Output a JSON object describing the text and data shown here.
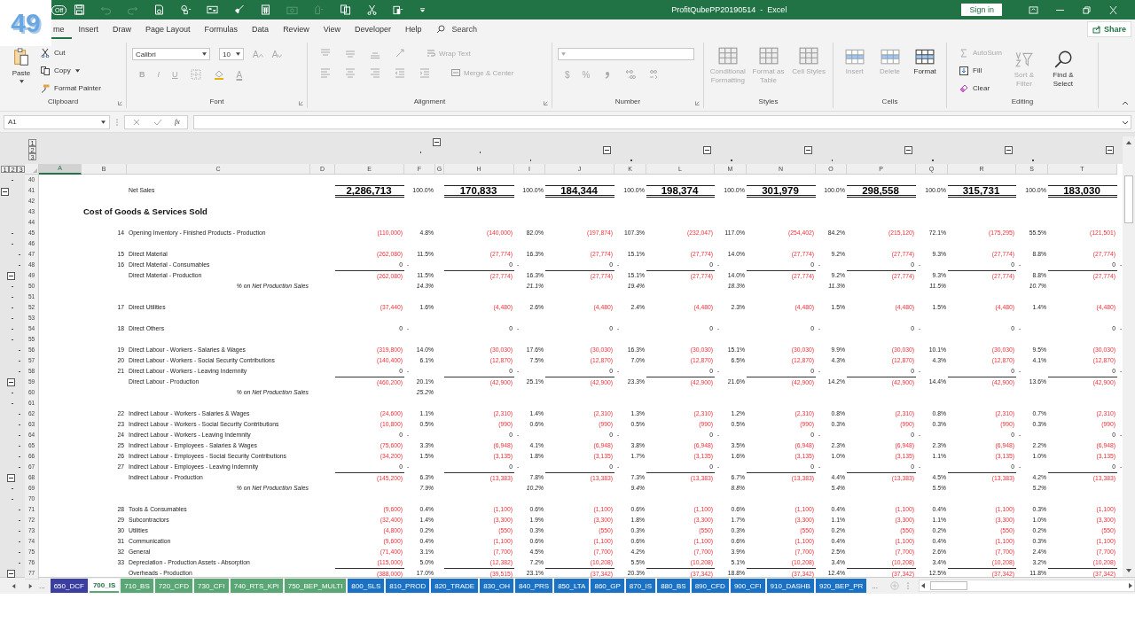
{
  "badge": "49",
  "title_bar": {
    "autosave": "Off",
    "title": "ProfitQubePP20190514  -  Excel",
    "sign_in": "Sign in",
    "quick_access": [
      {
        "kind": "save",
        "disabled": false
      },
      {
        "kind": "undo",
        "disabled": true
      },
      {
        "kind": "redo",
        "disabled": true
      },
      {
        "kind": "doc",
        "disabled": false
      },
      {
        "kind": "touch",
        "disabled": false
      },
      {
        "kind": "form",
        "disabled": false
      },
      {
        "kind": "brush",
        "disabled": false
      },
      {
        "kind": "calc",
        "disabled": false
      },
      {
        "kind": "camera",
        "disabled": true
      },
      {
        "kind": "hand",
        "disabled": true
      },
      {
        "kind": "copy",
        "disabled": false
      },
      {
        "kind": "cut",
        "disabled": false
      },
      {
        "kind": "paste",
        "disabled": false
      },
      {
        "kind": "more",
        "disabled": false
      }
    ]
  },
  "menu": {
    "tabs": [
      {
        "label": "me",
        "selected": true
      },
      {
        "label": "Insert",
        "selected": false
      },
      {
        "label": "Draw",
        "selected": false
      },
      {
        "label": "Page Layout",
        "selected": false
      },
      {
        "label": "Formulas",
        "selected": false
      },
      {
        "label": "Data",
        "selected": false
      },
      {
        "label": "Review",
        "selected": false
      },
      {
        "label": "View",
        "selected": false
      },
      {
        "label": "Developer",
        "selected": false
      },
      {
        "label": "Help",
        "selected": false
      }
    ],
    "search": {
      "placeholder": "Search"
    },
    "share": "Share"
  },
  "ribbon": {
    "clipboard": {
      "label": "Clipboard",
      "paste": "Paste",
      "cut": "Cut",
      "copy": "Copy",
      "format_painter": "Format Painter"
    },
    "font": {
      "label": "Font",
      "name": "Calibri",
      "size": "10",
      "disabled": true,
      "grow": "A",
      "shrink": "A",
      "bold": "B",
      "italic": "I",
      "underline": "U",
      "color_letter": "A"
    },
    "alignment": {
      "label": "Alignment",
      "disabled": true,
      "wrap_text": "Wrap Text",
      "merge": "Merge & Center"
    },
    "number": {
      "label": "Number",
      "disabled": true,
      "currency": "$",
      "percent": "%"
    },
    "styles": {
      "label": "Styles",
      "buttons": [
        {
          "label": "Conditional Formatting",
          "disabled": true
        },
        {
          "label": "Format as Table",
          "disabled": true
        },
        {
          "label": "Cell Styles",
          "disabled": true
        }
      ]
    },
    "cells": {
      "label": "Cells",
      "buttons": [
        {
          "label": "Insert",
          "disabled": true
        },
        {
          "label": "Delete",
          "disabled": true
        },
        {
          "label": "Format",
          "disabled": false
        }
      ]
    },
    "editing": {
      "label": "Editing",
      "autosum": {
        "label": "AutoSum",
        "disabled": true
      },
      "fill": {
        "label": "Fill",
        "disabled": false
      },
      "clear": {
        "label": "Clear",
        "disabled": false
      },
      "sort": {
        "label": "Sort & Filter",
        "disabled": true
      },
      "find": {
        "label": "Find & Select",
        "disabled": false
      }
    }
  },
  "formula_bar": {
    "name_box": "A1",
    "fx": "fx"
  },
  "sheet": {
    "column_level_buttons": [
      "1",
      "2",
      "3"
    ],
    "row_level_buttons": [
      "1",
      "2",
      "3"
    ],
    "columns": [
      {
        "letter": "A",
        "selected": true
      },
      {
        "letter": "B",
        "selected": false
      },
      {
        "letter": "C",
        "selected": false
      },
      {
        "letter": "D",
        "selected": false
      },
      {
        "letter": "E",
        "selected": false
      },
      {
        "letter": "F",
        "selected": false,
        "outline": {
          "kind": "dot-mid"
        }
      },
      {
        "letter": "G",
        "selected": false,
        "outline": {
          "kind": "collapse-outer"
        }
      },
      {
        "letter": "H",
        "selected": false,
        "outline": {
          "kind": "dot-mid"
        }
      },
      {
        "letter": "I",
        "selected": false,
        "outline": {
          "kind": "dot-inner"
        }
      },
      {
        "letter": "J",
        "selected": false,
        "outline": {
          "kind": "collapse-mid"
        }
      },
      {
        "letter": "K",
        "selected": false,
        "outline": {
          "kind": "dot-inner"
        }
      },
      {
        "letter": "L",
        "selected": false,
        "outline": {
          "kind": "collapse-mid"
        }
      },
      {
        "letter": "M",
        "selected": false,
        "outline": {
          "kind": "dot-inner"
        }
      },
      {
        "letter": "N",
        "selected": false,
        "outline": {
          "kind": "collapse-mid"
        }
      },
      {
        "letter": "O",
        "selected": false,
        "outline": {
          "kind": "dot-inner"
        }
      },
      {
        "letter": "P",
        "selected": false,
        "outline": {
          "kind": "collapse-mid"
        }
      },
      {
        "letter": "Q",
        "selected": false,
        "outline": {
          "kind": "dot-inner"
        }
      },
      {
        "letter": "R",
        "selected": false,
        "outline": {
          "kind": "collapse-mid"
        }
      },
      {
        "letter": "S",
        "selected": false,
        "outline": {
          "kind": "dot-inner"
        }
      },
      {
        "letter": "T",
        "selected": false,
        "outline": {
          "kind": "collapse-mid"
        }
      }
    ],
    "rows": [
      {
        "row": "40",
        "outline": {
          "kind": "dot-mid"
        },
        "kind": "blank"
      },
      {
        "row": "41",
        "outline": {
          "kind": "collapse-outer"
        },
        "kind": "total",
        "label": "Net Sales",
        "values": [
          "2,286,713",
          "170,833",
          "184,344",
          "198,374",
          "301,979",
          "298,558",
          "315,731",
          "183,030"
        ],
        "shares": [
          "100.0%",
          "100.0%",
          "100.0%",
          "100.0%",
          "100.0%",
          "100.0%",
          "100.0%"
        ]
      },
      {
        "row": "42",
        "kind": "blank"
      },
      {
        "row": "43",
        "kind": "heading",
        "label": "Cost of Goods & Services Sold"
      },
      {
        "row": "44",
        "kind": "blank"
      },
      {
        "row": "45",
        "outline": {
          "kind": "dot-mid"
        },
        "kind": "item",
        "code": "14",
        "label": "Opening Inventory - Finished Products - Production",
        "values": [
          "(110,000)",
          "(140,000)",
          "(197,874)",
          "(232,047)",
          "(254,402)",
          "(215,120)",
          "(175,295)",
          "(121,501)"
        ],
        "shares": [
          "4.8%",
          "82.0%",
          "107.3%",
          "117.0%",
          "84.2%",
          "72.1%",
          "55.5%"
        ]
      },
      {
        "row": "46",
        "outline": {
          "kind": "dot-mid"
        },
        "kind": "blank"
      },
      {
        "row": "47",
        "outline": {
          "kind": "dot-inner"
        },
        "kind": "item",
        "code": "15",
        "label": "Direct Material",
        "values": [
          "(262,080)",
          "(27,774)",
          "(27,774)",
          "(27,774)",
          "(27,774)",
          "(27,774)",
          "(27,774)",
          "(27,774)"
        ],
        "shares": [
          "11.5%",
          "16.3%",
          "15.1%",
          "14.0%",
          "9.2%",
          "9.3%",
          "8.8%"
        ]
      },
      {
        "row": "48",
        "outline": {
          "kind": "dot-inner"
        },
        "kind": "zero",
        "code": "16",
        "label": "Direct Material - Consumables",
        "values": [
          "0",
          "0",
          "0",
          "0",
          "0",
          "0",
          "0",
          "0"
        ],
        "dashes": [
          "-",
          "-",
          "-",
          "-",
          "-",
          "-",
          "-",
          "-"
        ]
      },
      {
        "row": "49",
        "outline": {
          "kind": "collapse-mid"
        },
        "kind": "subtotal",
        "label": "Direct Material - Production",
        "values": [
          "(262,080)",
          "(27,774)",
          "(27,774)",
          "(27,774)",
          "(27,774)",
          "(27,774)",
          "(27,774)",
          "(27,774)"
        ],
        "shares": [
          "11.5%",
          "16.3%",
          "15.1%",
          "14.0%",
          "9.2%",
          "9.3%",
          "8.8%"
        ]
      },
      {
        "row": "50",
        "outline": {
          "kind": "dot-mid"
        },
        "kind": "ratio",
        "label": "% on Net Production Sales",
        "shares": [
          "14.3%",
          "21.1%",
          "19.4%",
          "18.3%",
          "11.3%",
          "11.5%",
          "10.7%"
        ]
      },
      {
        "row": "51",
        "outline": {
          "kind": "dot-mid"
        },
        "kind": "blank"
      },
      {
        "row": "52",
        "outline": {
          "kind": "dot-mid"
        },
        "kind": "item",
        "code": "17",
        "label": "Direct Utilities",
        "values": [
          "(37,440)",
          "(4,480)",
          "(4,480)",
          "(4,480)",
          "(4,480)",
          "(4,480)",
          "(4,480)",
          "(4,480)"
        ],
        "shares": [
          "1.6%",
          "2.6%",
          "2.4%",
          "2.3%",
          "1.5%",
          "1.5%",
          "1.4%"
        ]
      },
      {
        "row": "53",
        "outline": {
          "kind": "dot-mid"
        },
        "kind": "blank"
      },
      {
        "row": "54",
        "outline": {
          "kind": "dot-mid"
        },
        "kind": "zero",
        "code": "18",
        "label": "Direct Others",
        "values": [
          "0",
          "0",
          "0",
          "0",
          "0",
          "0",
          "0",
          "0"
        ],
        "dashes": [
          "-",
          "-",
          "-",
          "-",
          "-",
          "-",
          "-",
          "-"
        ]
      },
      {
        "row": "55",
        "outline": {
          "kind": "dot-mid"
        },
        "kind": "blank"
      },
      {
        "row": "56",
        "outline": {
          "kind": "dot-inner"
        },
        "kind": "item",
        "code": "19",
        "label": "Direct Labour - Workers - Salaries & Wages",
        "values": [
          "(319,800)",
          "(30,030)",
          "(30,030)",
          "(30,030)",
          "(30,030)",
          "(30,030)",
          "(30,030)",
          "(30,030)"
        ],
        "shares": [
          "14.0%",
          "17.6%",
          "16.3%",
          "15.1%",
          "9.9%",
          "10.1%",
          "9.5%"
        ]
      },
      {
        "row": "57",
        "outline": {
          "kind": "dot-inner"
        },
        "kind": "item",
        "code": "20",
        "label": "Direct Labour - Workers - Social Security Contributions",
        "values": [
          "(140,400)",
          "(12,870)",
          "(12,870)",
          "(12,870)",
          "(12,870)",
          "(12,870)",
          "(12,870)",
          "(12,870)"
        ],
        "shares": [
          "6.1%",
          "7.5%",
          "7.0%",
          "6.5%",
          "4.3%",
          "4.3%",
          "4.1%"
        ]
      },
      {
        "row": "58",
        "outline": {
          "kind": "dot-inner"
        },
        "kind": "zero",
        "code": "21",
        "label": "Direct Labour - Workers - Leaving Indemnity",
        "values": [
          "0",
          "0",
          "0",
          "0",
          "0",
          "0",
          "0",
          "0"
        ],
        "dashes": [
          "-",
          "-",
          "-",
          "-",
          "-",
          "-",
          "-",
          "-"
        ]
      },
      {
        "row": "59",
        "outline": {
          "kind": "collapse-mid"
        },
        "kind": "subtotal",
        "label": "Direct Labour - Production",
        "values": [
          "(460,200)",
          "(42,900)",
          "(42,900)",
          "(42,900)",
          "(42,900)",
          "(42,900)",
          "(42,900)",
          "(42,900)"
        ],
        "shares": [
          "20.1%",
          "25.1%",
          "23.3%",
          "21.6%",
          "14.2%",
          "14.4%",
          "13.6%"
        ]
      },
      {
        "row": "60",
        "outline": {
          "kind": "dot-mid"
        },
        "kind": "ratio",
        "label": "% on Net Production Sales",
        "shares": [
          "25.2%"
        ]
      },
      {
        "row": "61",
        "outline": {
          "kind": "dot-mid"
        },
        "kind": "blank"
      },
      {
        "row": "62",
        "outline": {
          "kind": "dot-inner"
        },
        "kind": "item",
        "code": "22",
        "label": "Indirect Labour - Workers - Salaries & Wages",
        "values": [
          "(24,600)",
          "(2,310)",
          "(2,310)",
          "(2,310)",
          "(2,310)",
          "(2,310)",
          "(2,310)",
          "(2,310)"
        ],
        "shares": [
          "1.1%",
          "1.4%",
          "1.3%",
          "1.2%",
          "0.8%",
          "0.8%",
          "0.7%"
        ]
      },
      {
        "row": "63",
        "outline": {
          "kind": "dot-inner"
        },
        "kind": "item",
        "code": "23",
        "label": "Indirect Labour - Workers - Social Security Contributions",
        "values": [
          "(10,800)",
          "(990)",
          "(990)",
          "(990)",
          "(990)",
          "(990)",
          "(990)",
          "(990)"
        ],
        "shares": [
          "0.5%",
          "0.6%",
          "0.5%",
          "0.5%",
          "0.3%",
          "0.3%",
          "0.3%"
        ]
      },
      {
        "row": "64",
        "outline": {
          "kind": "dot-inner"
        },
        "kind": "zero",
        "code": "24",
        "label": "Indirect Labour - Workers - Leaving Indemnity",
        "values": [
          "0",
          "0",
          "0",
          "0",
          "0",
          "0",
          "0",
          "0"
        ],
        "dashes": [
          "-",
          "-",
          "-",
          "-",
          "-",
          "-",
          "-",
          "-"
        ]
      },
      {
        "row": "65",
        "outline": {
          "kind": "dot-inner"
        },
        "kind": "item",
        "code": "25",
        "label": "Indirect Labour - Employees - Salaries & Wages",
        "values": [
          "(75,600)",
          "(6,948)",
          "(6,948)",
          "(6,948)",
          "(6,948)",
          "(6,948)",
          "(6,948)",
          "(6,948)"
        ],
        "shares": [
          "3.3%",
          "4.1%",
          "3.8%",
          "3.5%",
          "2.3%",
          "2.3%",
          "2.2%"
        ]
      },
      {
        "row": "66",
        "outline": {
          "kind": "dot-inner"
        },
        "kind": "item",
        "code": "26",
        "label": "Indirect Labour - Employees - Social Security Contributions",
        "values": [
          "(34,200)",
          "(3,135)",
          "(3,135)",
          "(3,135)",
          "(3,135)",
          "(3,135)",
          "(3,135)",
          "(3,135)"
        ],
        "shares": [
          "1.5%",
          "1.8%",
          "1.7%",
          "1.6%",
          "1.0%",
          "1.1%",
          "1.0%"
        ]
      },
      {
        "row": "67",
        "outline": {
          "kind": "dot-inner"
        },
        "kind": "zero",
        "code": "27",
        "label": "Indirect Labour - Employees - Leaving Indemnity",
        "values": [
          "0",
          "0",
          "0",
          "0",
          "0",
          "0",
          "0",
          "0"
        ],
        "dashes": [
          "-",
          "-",
          "-",
          "-",
          "-",
          "-",
          "-",
          "-"
        ]
      },
      {
        "row": "68",
        "outline": {
          "kind": "collapse-mid"
        },
        "kind": "subtotal",
        "label": "Indirect Labour - Production",
        "values": [
          "(145,200)",
          "(13,383)",
          "(13,383)",
          "(13,383)",
          "(13,383)",
          "(13,383)",
          "(13,383)",
          "(13,383)"
        ],
        "shares": [
          "6.3%",
          "7.8%",
          "7.3%",
          "6.7%",
          "4.4%",
          "4.5%",
          "4.2%"
        ]
      },
      {
        "row": "69",
        "outline": {
          "kind": "dot-mid"
        },
        "kind": "ratio",
        "label": "% on Net Production Sales",
        "shares": [
          "7.9%",
          "10.2%",
          "9.4%",
          "8.8%",
          "5.4%",
          "5.5%",
          "5.2%"
        ]
      },
      {
        "row": "70",
        "outline": {
          "kind": "dot-mid"
        },
        "kind": "blank"
      },
      {
        "row": "71",
        "outline": {
          "kind": "dot-inner"
        },
        "kind": "item",
        "code": "28",
        "label": "Tools & Consumables",
        "values": [
          "(9,600)",
          "(1,100)",
          "(1,100)",
          "(1,100)",
          "(1,100)",
          "(1,100)",
          "(1,100)",
          "(1,100)"
        ],
        "shares": [
          "0.4%",
          "0.6%",
          "0.6%",
          "0.6%",
          "0.4%",
          "0.4%",
          "0.3%"
        ]
      },
      {
        "row": "72",
        "outline": {
          "kind": "dot-inner"
        },
        "kind": "item",
        "code": "29",
        "label": "Subcontractors",
        "values": [
          "(32,400)",
          "(3,300)",
          "(3,300)",
          "(3,300)",
          "(3,300)",
          "(3,300)",
          "(3,300)",
          "(3,300)"
        ],
        "shares": [
          "1.4%",
          "1.9%",
          "1.8%",
          "1.7%",
          "1.1%",
          "1.1%",
          "1.0%"
        ]
      },
      {
        "row": "73",
        "outline": {
          "kind": "dot-inner"
        },
        "kind": "item",
        "code": "30",
        "label": "Utilities",
        "values": [
          "(4,800)",
          "(550)",
          "(550)",
          "(550)",
          "(550)",
          "(550)",
          "(550)",
          "(550)"
        ],
        "shares": [
          "0.2%",
          "0.3%",
          "0.3%",
          "0.3%",
          "0.2%",
          "0.2%",
          "0.2%"
        ]
      },
      {
        "row": "74",
        "outline": {
          "kind": "dot-inner"
        },
        "kind": "item",
        "code": "31",
        "label": "Communication",
        "values": [
          "(9,600)",
          "(1,100)",
          "(1,100)",
          "(1,100)",
          "(1,100)",
          "(1,100)",
          "(1,100)",
          "(1,100)"
        ],
        "shares": [
          "0.4%",
          "0.6%",
          "0.6%",
          "0.6%",
          "0.4%",
          "0.4%",
          "0.3%"
        ]
      },
      {
        "row": "75",
        "outline": {
          "kind": "dot-inner"
        },
        "kind": "item",
        "code": "32",
        "label": "General",
        "values": [
          "(71,400)",
          "(7,700)",
          "(7,700)",
          "(7,700)",
          "(7,700)",
          "(7,700)",
          "(7,700)",
          "(7,700)"
        ],
        "shares": [
          "3.1%",
          "4.5%",
          "4.2%",
          "3.9%",
          "2.5%",
          "2.6%",
          "2.4%"
        ]
      },
      {
        "row": "76",
        "outline": {
          "kind": "dot-inner"
        },
        "kind": "item",
        "code": "33",
        "label": "Depreciation - Production Assets - Absorption",
        "values": [
          "(115,000)",
          "(12,382)",
          "(10,208)",
          "(10,208)",
          "(10,208)",
          "(10,208)",
          "(10,208)",
          "(10,208)"
        ],
        "shares": [
          "5.0%",
          "7.2%",
          "5.5%",
          "5.1%",
          "3.4%",
          "3.4%",
          "3.2%"
        ]
      },
      {
        "row": "77",
        "outline": {
          "kind": "collapse-mid"
        },
        "kind": "subtotal",
        "label": "Overheads - Production",
        "values": [
          "(388,000)",
          "(39,515)",
          "(37,342)",
          "(37,342)",
          "(37,342)",
          "(37,342)",
          "(37,342)",
          "(37,342)"
        ],
        "shares": [
          "17.0%",
          "23.1%",
          "20.3%",
          "18.8%",
          "12.4%",
          "12.5%",
          "11.8%"
        ]
      }
    ]
  },
  "sheet_tabs": {
    "more_left": "...",
    "more_right": "...",
    "tabs": [
      {
        "label": "650_DCF",
        "color": "#3b3ea0",
        "selected": false
      },
      {
        "label": "700_IS",
        "color": "#5aa775",
        "selected": true
      },
      {
        "label": "710_BS",
        "color": "#5aa775",
        "selected": false
      },
      {
        "label": "720_CFD",
        "color": "#5aa775",
        "selected": false
      },
      {
        "label": "730_CFI",
        "color": "#5aa775",
        "selected": false
      },
      {
        "label": "740_RTS_KPI",
        "color": "#5aa775",
        "selected": false
      },
      {
        "label": "750_BEP_MULTI",
        "color": "#5aa775",
        "selected": false
      },
      {
        "label": "800_SLS",
        "color": "#1b72c4",
        "selected": false
      },
      {
        "label": "810_PROD",
        "color": "#1b72c4",
        "selected": false
      },
      {
        "label": "820_TRADE",
        "color": "#1b72c4",
        "selected": false
      },
      {
        "label": "830_OH",
        "color": "#1b72c4",
        "selected": false
      },
      {
        "label": "840_PRS",
        "color": "#1b72c4",
        "selected": false
      },
      {
        "label": "850_LTA",
        "color": "#1b72c4",
        "selected": false
      },
      {
        "label": "860_GP",
        "color": "#1b72c4",
        "selected": false
      },
      {
        "label": "870_IS",
        "color": "#1b72c4",
        "selected": false
      },
      {
        "label": "880_BS",
        "color": "#1b72c4",
        "selected": false
      },
      {
        "label": "890_CFD",
        "color": "#1b72c4",
        "selected": false
      },
      {
        "label": "900_CFI",
        "color": "#1b72c4",
        "selected": false
      },
      {
        "label": "910_DASHB",
        "color": "#1b72c4",
        "selected": false
      },
      {
        "label": "920_BEP_PR",
        "color": "#1b72c4",
        "selected": false
      }
    ]
  }
}
